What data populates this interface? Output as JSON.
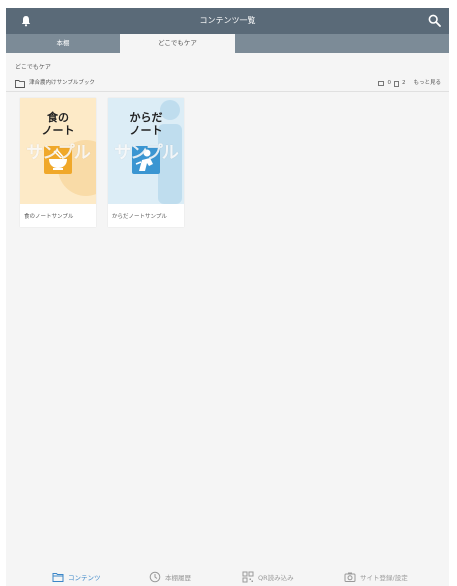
{
  "header": {
    "title": "コンテンツ一覧"
  },
  "tabs": [
    {
      "label": "本棚"
    },
    {
      "label": "どこでもケア"
    }
  ],
  "breadcrumb": "どこでもケア",
  "book": {
    "name": "津合農内けサンプルブック",
    "folder_count": "0",
    "doc_count": "2",
    "more_label": "もっと見る"
  },
  "cards": [
    {
      "line1": "食の",
      "line2": "ノート",
      "watermark": "サンプル",
      "label": "食のノートサンプル",
      "bg": "#fdeac7",
      "accent": "#f0a82a"
    },
    {
      "line1": "からだ",
      "line2": "ノート",
      "watermark": "サンプル",
      "label": "からだノートサンプル",
      "bg": "#dcedf6",
      "accent": "#3b96d2"
    }
  ],
  "footer_nav": [
    {
      "label": "コンテンツ",
      "icon": "content-icon",
      "active": true
    },
    {
      "label": "本棚履歴",
      "icon": "history-clock-icon",
      "active": false
    },
    {
      "label": "QR読み込み",
      "icon": "qr-code-icon",
      "active": false
    },
    {
      "label": "サイト登録/設定",
      "icon": "settings-camera-icon",
      "active": false
    }
  ],
  "colors": {
    "header": "#5a6a78",
    "tabbar": "#7c8b97",
    "active_nav": "#3b86c8"
  }
}
